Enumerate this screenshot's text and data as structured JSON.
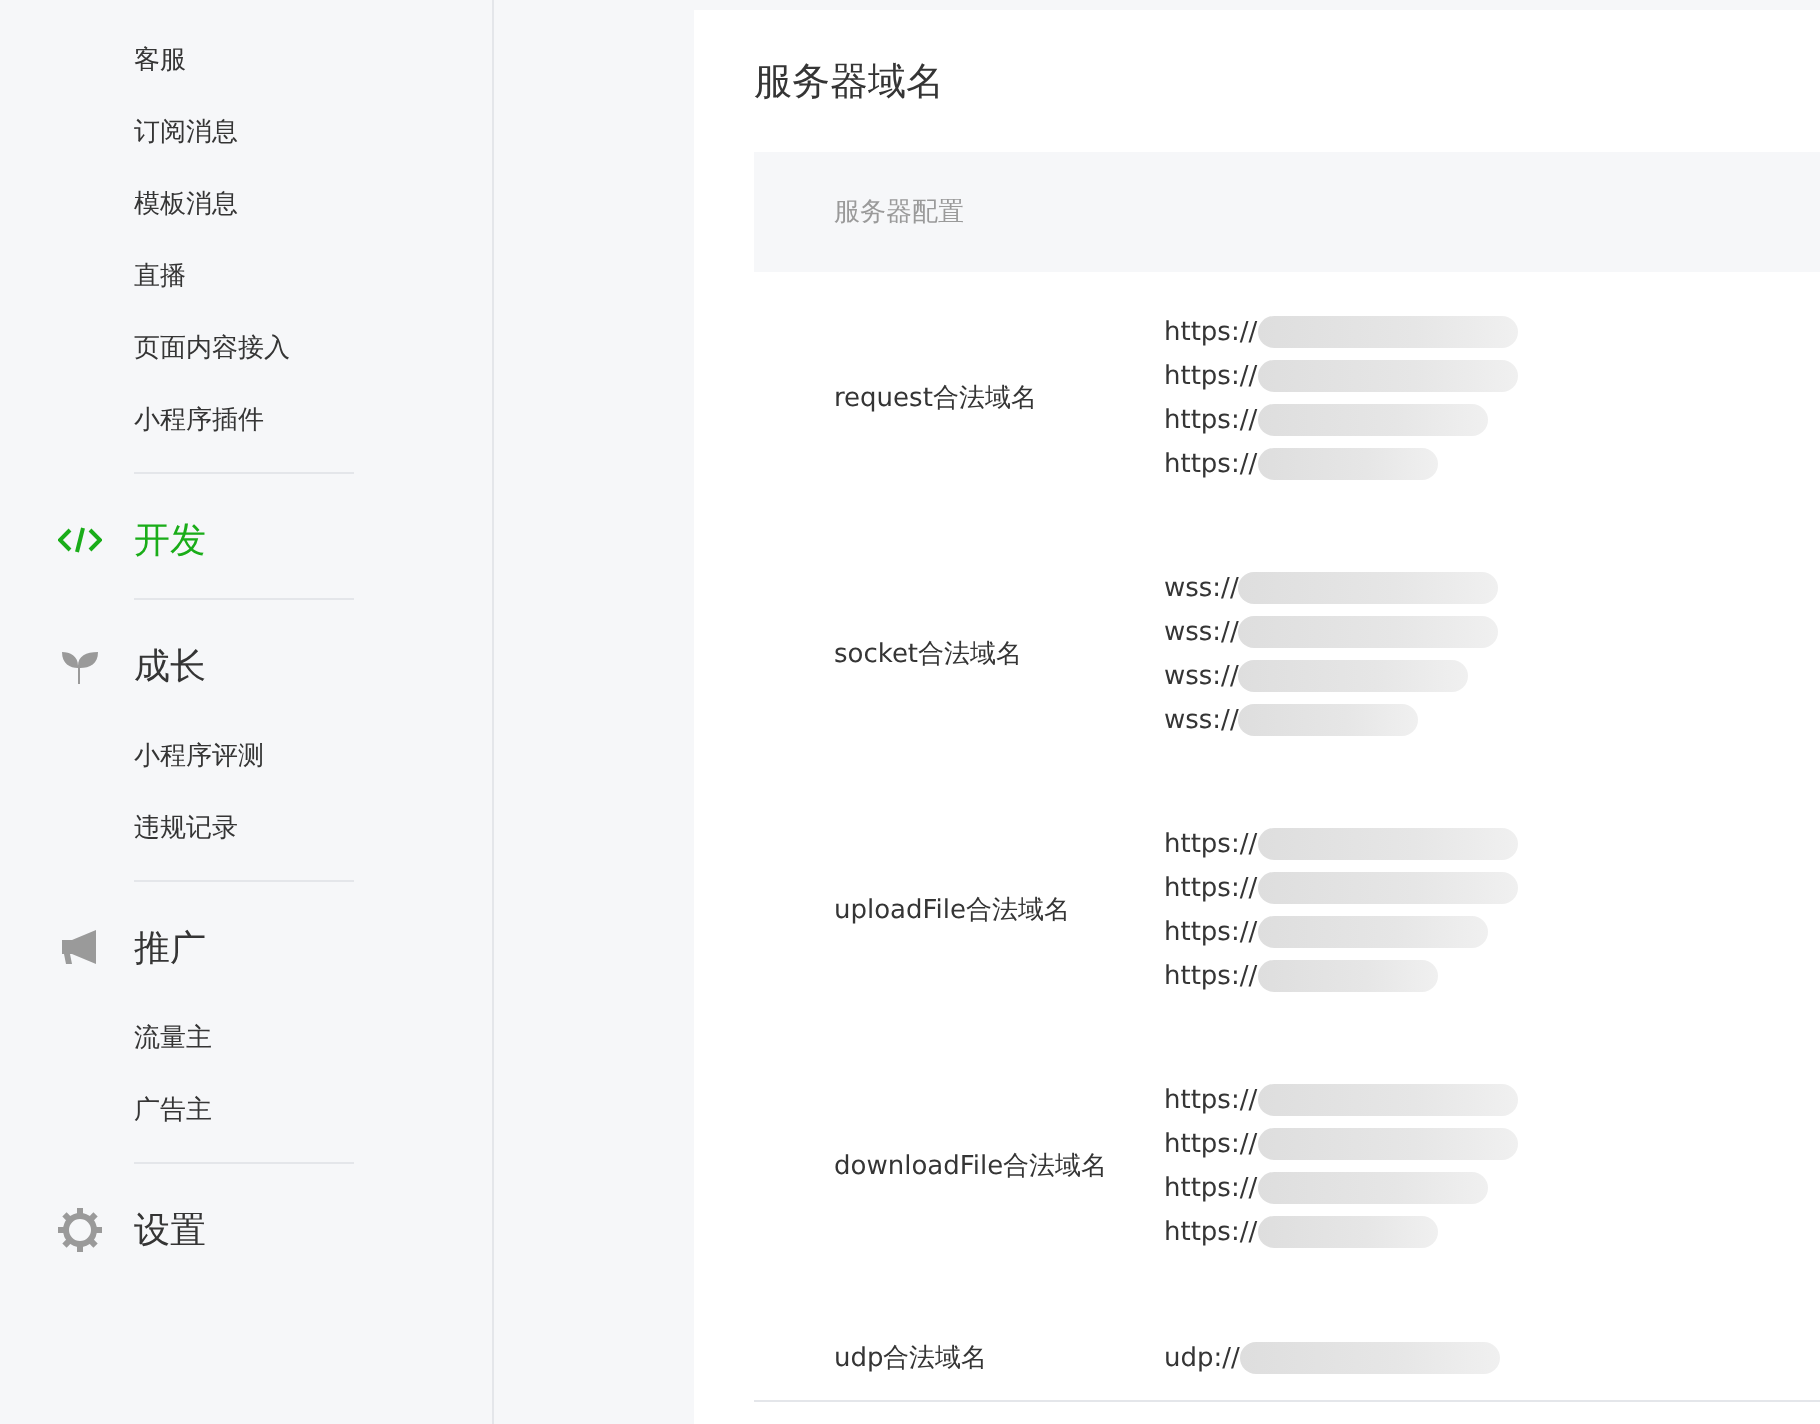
{
  "sidebar": {
    "items": [
      {
        "kind": "sub",
        "label": "客服",
        "selected": false
      },
      {
        "kind": "sub",
        "label": "订阅消息",
        "selected": false
      },
      {
        "kind": "sub",
        "label": "模板消息",
        "selected": false
      },
      {
        "kind": "sub",
        "label": "直播",
        "selected": false
      },
      {
        "kind": "sub",
        "label": "页面内容接入",
        "selected": false
      },
      {
        "kind": "sub",
        "label": "小程序插件",
        "selected": false
      },
      {
        "kind": "divider"
      },
      {
        "kind": "group",
        "label": "开发",
        "selected": true
      },
      {
        "kind": "divider"
      },
      {
        "kind": "group",
        "label": "成长",
        "selected": false
      },
      {
        "kind": "sub",
        "label": "小程序评测",
        "selected": false
      },
      {
        "kind": "sub",
        "label": "违规记录",
        "selected": false
      },
      {
        "kind": "divider"
      },
      {
        "kind": "group",
        "label": "推广",
        "selected": false
      },
      {
        "kind": "sub",
        "label": "流量主",
        "selected": false
      },
      {
        "kind": "sub",
        "label": "广告主",
        "selected": false
      },
      {
        "kind": "divider"
      },
      {
        "kind": "group",
        "label": "设置",
        "selected": false
      }
    ]
  },
  "card": {
    "title": "服务器域名",
    "table": {
      "header": "服务器配置",
      "rows": [
        {
          "label": "request合法域名",
          "values": [
            "https://",
            "https://",
            "https://",
            "https://"
          ]
        },
        {
          "label": "socket合法域名",
          "values": [
            "wss://",
            "wss://",
            "wss://",
            "wss://"
          ]
        },
        {
          "label": "uploadFile合法域名",
          "values": [
            "https://",
            "https://",
            "https://",
            "https://"
          ]
        },
        {
          "label": "downloadFile合法域名",
          "values": [
            "https://",
            "https://",
            "https://",
            "https://"
          ]
        },
        {
          "label": "udp合法域名",
          "values": [
            "udp://"
          ]
        }
      ]
    }
  }
}
